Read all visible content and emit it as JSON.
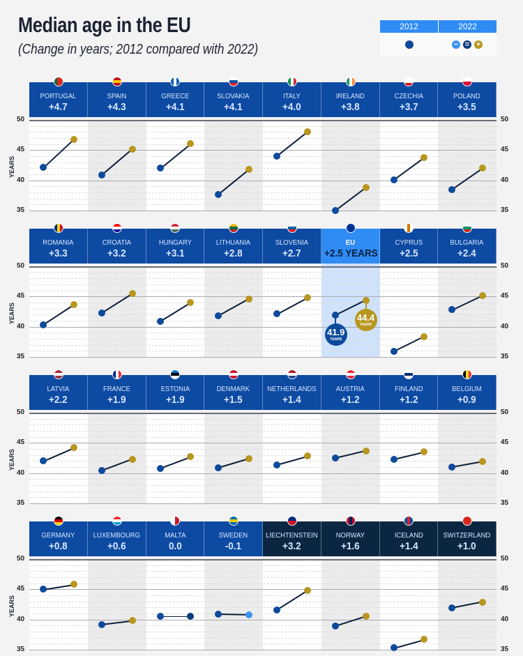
{
  "title": "Median age in the EU",
  "subtitle": "(Change in years; 2012 compared with 2022)",
  "legend": {
    "col1": "2012",
    "col2": "2022",
    "minus": "−",
    "equal": "=",
    "plus": "+"
  },
  "colors": {
    "header": "#0d4aa2",
    "header_eu": "#2f8cf5",
    "header_efta": "#0b2642",
    "dot_2012": "#0d4a9c",
    "dot_2022_increase": "#b8961f",
    "dot_2022_decrease": "#3d94ef",
    "dot_2022_same": "#0b3a7a",
    "eu_column": "#cfe2fb",
    "alt_column": "#ececec"
  },
  "chart_data": {
    "type": "slope",
    "ylabel": "YEARS",
    "ylim": [
      35,
      50
    ],
    "yticks": [
      "50",
      "45",
      "40",
      "35"
    ],
    "series_names": [
      "2012",
      "2022"
    ],
    "rows": [
      [
        {
          "name": "PORTUGAL",
          "change": "+4.7",
          "v2012": 42.1,
          "v2022": 46.8,
          "flag": [
            "#046a38",
            "#da291c",
            "#da291c"
          ]
        },
        {
          "name": "SPAIN",
          "change": "+4.3",
          "v2012": 40.9,
          "v2022": 45.2,
          "flag": [
            "#c60b1e",
            "#ffc400",
            "#c60b1e"
          ],
          "h": true
        },
        {
          "name": "GREECE",
          "change": "+4.1",
          "v2012": 42.0,
          "v2022": 46.1,
          "flag": [
            "#0d5eaf",
            "#ffffff",
            "#0d5eaf"
          ]
        },
        {
          "name": "SLOVAKIA",
          "change": "+4.1",
          "v2012": 37.7,
          "v2022": 41.8,
          "flag": [
            "#ffffff",
            "#0b4ea2",
            "#ee1c25"
          ],
          "h": true
        },
        {
          "name": "ITALY",
          "change": "+4.0",
          "v2012": 44.0,
          "v2022": 48.0,
          "flag": [
            "#009246",
            "#ffffff",
            "#ce2b37"
          ]
        },
        {
          "name": "IRELAND",
          "change": "+3.8",
          "v2012": 35.0,
          "v2022": 38.8,
          "flag": [
            "#169b62",
            "#ffffff",
            "#ff883e"
          ]
        },
        {
          "name": "CZECHIA",
          "change": "+3.7",
          "v2012": 40.1,
          "v2022": 43.8,
          "flag": [
            "#ffffff",
            "#ffffff",
            "#d7141a"
          ],
          "h": true
        },
        {
          "name": "POLAND",
          "change": "+3.5",
          "v2012": 38.5,
          "v2022": 42.0,
          "flag": [
            "#ffffff",
            "#dc143c"
          ],
          "h": true
        }
      ],
      [
        {
          "name": "ROMANIA",
          "change": "+3.3",
          "v2012": 40.3,
          "v2022": 43.6,
          "flag": [
            "#002b7f",
            "#fcd116",
            "#ce1126"
          ]
        },
        {
          "name": "CROATIA",
          "change": "+3.2",
          "v2012": 42.3,
          "v2022": 45.5,
          "flag": [
            "#ff0000",
            "#ffffff",
            "#171796"
          ],
          "h": true
        },
        {
          "name": "HUNGARY",
          "change": "+3.1",
          "v2012": 40.9,
          "v2022": 44.0,
          "flag": [
            "#ce2939",
            "#ffffff",
            "#477050"
          ],
          "h": true
        },
        {
          "name": "LITHUANIA",
          "change": "+2.8",
          "v2012": 41.8,
          "v2022": 44.6,
          "flag": [
            "#fdb913",
            "#006a44",
            "#c1272d"
          ],
          "h": true
        },
        {
          "name": "SLOVENIA",
          "change": "+2.7",
          "v2012": 42.1,
          "v2022": 44.8,
          "flag": [
            "#ffffff",
            "#005da4",
            "#ed1c24"
          ],
          "h": true
        },
        {
          "name": "EU",
          "change": "+2.5 YEARS",
          "v2012": 41.9,
          "v2022": 44.4,
          "flag": [
            "#003399"
          ],
          "eu": true,
          "label2012": "41.9",
          "label2022": "44.4",
          "unit": "YEARS"
        },
        {
          "name": "CYPRUS",
          "change": "+2.5",
          "v2012": 35.9,
          "v2022": 38.4,
          "flag": [
            "#ffffff",
            "#d57800",
            "#ffffff"
          ]
        },
        {
          "name": "BULGARIA",
          "change": "+2.4",
          "v2012": 42.8,
          "v2022": 45.2,
          "flag": [
            "#ffffff",
            "#00966e",
            "#d62612"
          ],
          "h": true
        }
      ],
      [
        {
          "name": "LATVIA",
          "change": "+2.2",
          "v2012": 42.0,
          "v2022": 44.2,
          "flag": [
            "#9e3039",
            "#ffffff",
            "#9e3039"
          ],
          "h": true
        },
        {
          "name": "FRANCE",
          "change": "+1.9",
          "v2012": 40.4,
          "v2022": 42.3,
          "flag": [
            "#002395",
            "#ffffff",
            "#ed2939"
          ]
        },
        {
          "name": "ESTONIA",
          "change": "+1.9",
          "v2012": 40.8,
          "v2022": 42.7,
          "flag": [
            "#0072ce",
            "#000000",
            "#ffffff"
          ],
          "h": true
        },
        {
          "name": "DENMARK",
          "change": "+1.5",
          "v2012": 40.9,
          "v2022": 42.4,
          "flag": [
            "#c8102e",
            "#ffffff",
            "#c8102e"
          ],
          "h": true
        },
        {
          "name": "NETHERLANDS",
          "change": "+1.4",
          "v2012": 41.4,
          "v2022": 42.8,
          "flag": [
            "#ae1c28",
            "#ffffff",
            "#21468b"
          ],
          "h": true
        },
        {
          "name": "AUSTRIA",
          "change": "+1.2",
          "v2012": 42.5,
          "v2022": 43.7,
          "flag": [
            "#ed2939",
            "#ffffff",
            "#ed2939"
          ],
          "h": true
        },
        {
          "name": "FINLAND",
          "change": "+1.2",
          "v2012": 42.3,
          "v2022": 43.5,
          "flag": [
            "#ffffff",
            "#002f6c",
            "#ffffff"
          ],
          "h": true
        },
        {
          "name": "BELGIUM",
          "change": "+0.9",
          "v2012": 41.0,
          "v2022": 41.9,
          "flag": [
            "#000000",
            "#fdda24",
            "#ef3340"
          ]
        }
      ],
      [
        {
          "name": "GERMANY",
          "change": "+0.8",
          "v2012": 45.0,
          "v2022": 45.8,
          "flag": [
            "#000000",
            "#dd0000",
            "#ffce00"
          ],
          "h": true
        },
        {
          "name": "LUXEMBOURG",
          "change": "+0.6",
          "v2012": 39.2,
          "v2022": 39.8,
          "flag": [
            "#ed2939",
            "#ffffff",
            "#00a1de"
          ],
          "h": true
        },
        {
          "name": "MALTA",
          "change": "0.0",
          "v2012": 40.5,
          "v2022": 40.5,
          "flag": [
            "#ffffff",
            "#cf142b"
          ]
        },
        {
          "name": "SWEDEN",
          "change": "-0.1",
          "v2012": 40.9,
          "v2022": 40.8,
          "flag": [
            "#006aa7",
            "#fecc00",
            "#006aa7"
          ],
          "h": true
        },
        {
          "name": "LIECHTENSTEIN",
          "change": "+3.2",
          "v2012": 41.6,
          "v2022": 44.8,
          "flag": [
            "#002b7f",
            "#ce1126"
          ],
          "h": true,
          "efta": true
        },
        {
          "name": "NORWAY",
          "change": "+1.6",
          "v2012": 38.9,
          "v2022": 40.5,
          "flag": [
            "#ba0c2f",
            "#00205b",
            "#ba0c2f"
          ],
          "efta": true
        },
        {
          "name": "ICELAND",
          "change": "+1.4",
          "v2012": 35.3,
          "v2022": 36.7,
          "flag": [
            "#02529c",
            "#dc1e35",
            "#02529c"
          ],
          "efta": true
        },
        {
          "name": "SWITZERLAND",
          "change": "+1.0",
          "v2012": 41.9,
          "v2022": 42.9,
          "flag": [
            "#da291c"
          ],
          "efta": true
        }
      ]
    ]
  }
}
